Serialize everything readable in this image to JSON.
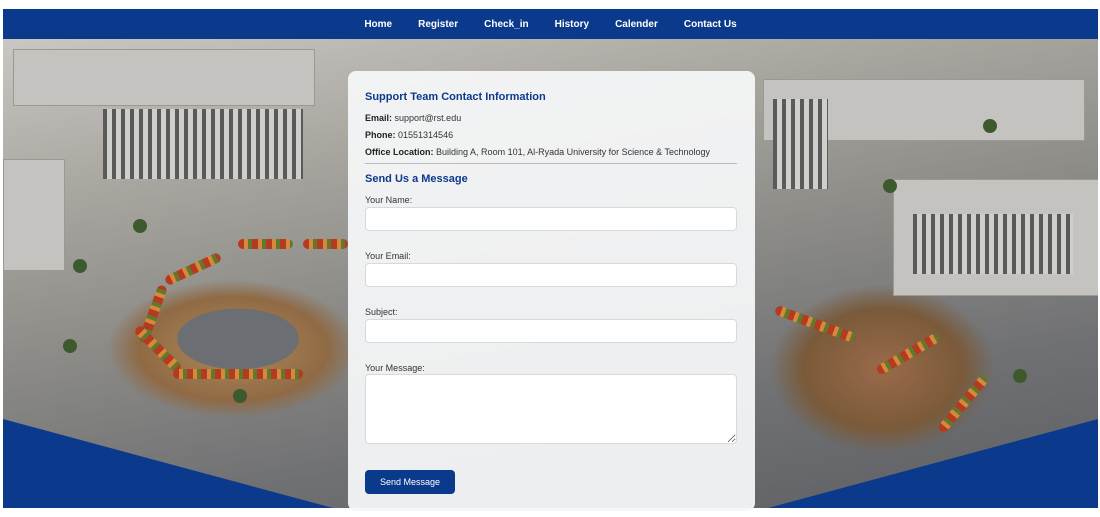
{
  "nav": {
    "items": [
      "Home",
      "Register",
      "Check_in",
      "History",
      "Calender",
      "Contact Us"
    ]
  },
  "contact": {
    "title": "Support Team Contact Information",
    "email_label": "Email:",
    "email_value": "support@rst.edu",
    "phone_label": "Phone:",
    "phone_value": "01551314546",
    "office_label": "Office Location:",
    "office_value": "Building A, Room 101, Al-Ryada University for Science & Technology"
  },
  "form": {
    "title": "Send Us a Message",
    "name_label": "Your Name:",
    "email_label": "Your Email:",
    "subject_label": "Subject:",
    "message_label": "Your Message:",
    "submit_label": "Send Message"
  },
  "colors": {
    "brand": "#0b3a8c",
    "card_bg": "#f5f6f8"
  }
}
